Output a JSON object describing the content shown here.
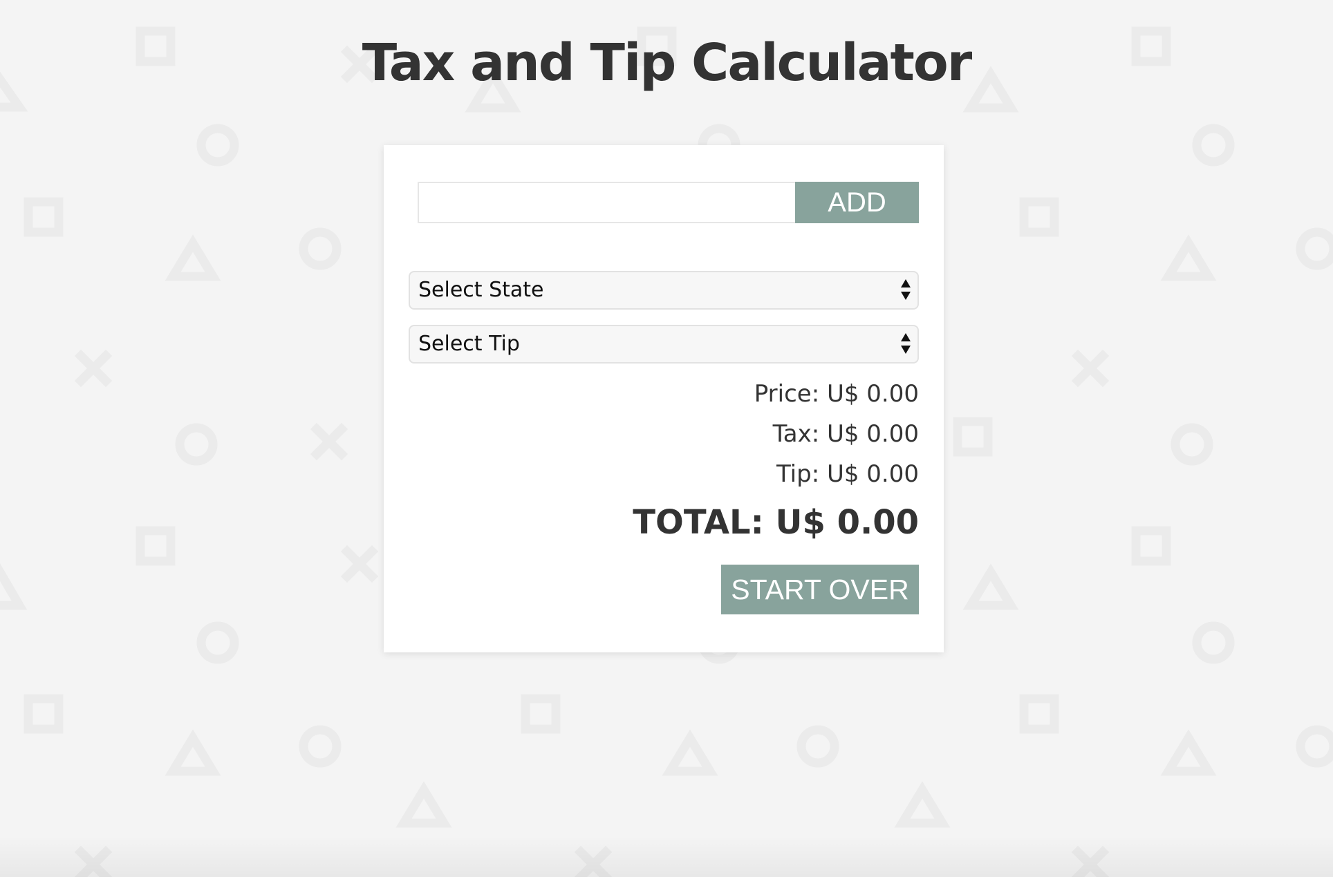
{
  "page": {
    "title": "Tax and Tip Calculator"
  },
  "form": {
    "price_input": {
      "value": "",
      "placeholder": ""
    },
    "add_label": "ADD",
    "state_select": {
      "selected": "Select State"
    },
    "tip_select": {
      "selected": "Select Tip"
    }
  },
  "summary": {
    "price_label": "Price:",
    "price_value": "U$ 0.00",
    "tax_label": "Tax:",
    "tax_value": "U$ 0.00",
    "tip_label": "Tip:",
    "tip_value": "U$ 0.00",
    "total_label": "TOTAL:",
    "total_value": "U$ 0.00"
  },
  "actions": {
    "start_over_label": "START OVER"
  },
  "colors": {
    "background": "#f4f4f4",
    "card": "#ffffff",
    "accent_button": "#88a39c",
    "text": "#333333",
    "pattern_shape": "#ebebeb"
  },
  "icons": {
    "select_arrows": "up-down-triangle-arrows-icon",
    "background_shapes": [
      "square-icon",
      "circle-icon",
      "triangle-icon",
      "cross-icon"
    ]
  }
}
